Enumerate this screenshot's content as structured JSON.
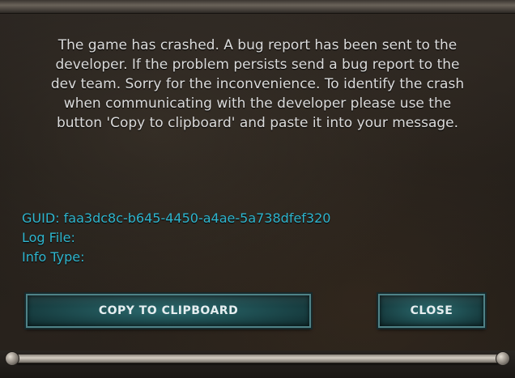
{
  "dialog": {
    "message": "The game has crashed. A bug report has been sent to the developer. If the problem persists send a bug report to the dev team. Sorry for the inconvenience. To identify the crash when communicating with the developer please use the button 'Copy to clipboard' and paste it into your message."
  },
  "info": {
    "guid_label": "GUID:",
    "guid_value": "faa3dc8c-b645-4450-a4ae-5a738dfef320",
    "log_file_label": "Log File:",
    "log_file_value": "",
    "info_type_label": "Info Type:",
    "info_type_value": ""
  },
  "buttons": {
    "copy_label": "COPY TO CLIPBOARD",
    "close_label": "CLOSE"
  },
  "colors": {
    "info_text": "#2fb6cf",
    "message_text": "#dcdcdc",
    "button_fill": "#2b6b6f",
    "button_text": "#e6eef0"
  }
}
